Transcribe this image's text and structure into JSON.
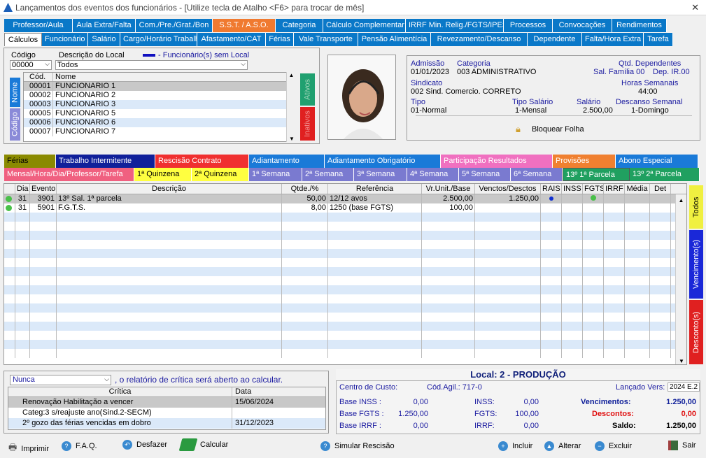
{
  "window": {
    "title": "Lançamentos dos eventos dos funcionários - [Utilize tecla de Atalho <F6> para trocar de mês]",
    "close": "✕"
  },
  "top_tabs_row1": [
    {
      "label": "Professor/Aula",
      "color": "#0a78c8"
    },
    {
      "label": "Aula Extra/Falta",
      "color": "#0a78c8"
    },
    {
      "label": "Com./Pre./Grat./Bon",
      "color": "#0a78c8"
    },
    {
      "label": "S.S.T. / A.S.O.",
      "color": "#f07a30"
    },
    {
      "label": "Categoria",
      "color": "#0a78c8"
    },
    {
      "label": "Cálculo Complementar",
      "color": "#0a78c8"
    },
    {
      "label": "IRRF Min. Relig./FGTS/IPESP",
      "color": "#0a78c8"
    },
    {
      "label": "Processos",
      "color": "#0a78c8"
    },
    {
      "label": "Convocações",
      "color": "#0a78c8"
    },
    {
      "label": "Rendimentos",
      "color": "#0a78c8"
    }
  ],
  "top_tabs_row2": [
    {
      "label": "Cálculos",
      "selected": true
    },
    {
      "label": "Funcionário"
    },
    {
      "label": "Salário"
    },
    {
      "label": "Cargo/Horário Trabalho"
    },
    {
      "label": "Afastamento/CAT"
    },
    {
      "label": "Férias"
    },
    {
      "label": "Vale Transporte"
    },
    {
      "label": "Pensão Alimentícia"
    },
    {
      "label": "Revezamento/Descanso"
    },
    {
      "label": "Dependente"
    },
    {
      "label": "Falta/Hora Extra"
    },
    {
      "label": "Tarefa"
    }
  ],
  "filter": {
    "codigo_label": "Código",
    "descricao_label": "Descrição do Local",
    "legend": "- Funcionário(s) sem Local",
    "codigo_value": "00000",
    "descricao_value": "Todos"
  },
  "emp_list": {
    "col_cod": "Cód.",
    "col_nome": "Nome",
    "rows": [
      {
        "cod": "00001",
        "nome": "FUNCIONARIO 1"
      },
      {
        "cod": "00002",
        "nome": "FUNCIONARIO 2"
      },
      {
        "cod": "00003",
        "nome": "FUNCIONARIO 3"
      },
      {
        "cod": "00005",
        "nome": "FUNCIONARIO 5"
      },
      {
        "cod": "00006",
        "nome": "FUNCIONARIO 6"
      },
      {
        "cod": "00007",
        "nome": "FUNCIONARIO 7"
      }
    ],
    "vtab_nome": "Nome",
    "vtab_codigo": "Código",
    "vtab_ativos": "Ativos",
    "vtab_inativos": "Inativos"
  },
  "info": {
    "admissao_l": "Admissão",
    "admissao": "01/01/2023",
    "categoria_l": "Categoria",
    "categoria": "003  ADMINISTRATIVO",
    "qtd_dep_l": "Qtd. Dependentes",
    "sal_familia": "Sal. Família 00",
    "dep_ir": "Dep. IR.00",
    "sindicato_l": "Sindicato",
    "sindicato": "002  Sind. Comercio. CORRETO",
    "horas_l": "Horas Semanais",
    "horas": "44:00",
    "tipo_l": "Tipo",
    "tipo": "01-Normal",
    "tipo_sal_l": "Tipo Salário",
    "tipo_sal": "1-Mensal",
    "salario_l": "Salário",
    "salario": "2.500,00",
    "desc_sem_l": "Descanso Semanal",
    "desc_sem": "1-Domingo",
    "bloquear": "Bloquear Folha"
  },
  "mid_tabs_row1": [
    {
      "label": "Férias",
      "color": "#8a8a00",
      "text": "#000"
    },
    {
      "label": "Trabalho Intermitente",
      "color": "#10209a",
      "text": "#fff"
    },
    {
      "label": "Rescisão Contrato",
      "color": "#f03030",
      "text": "#fff"
    },
    {
      "label": "Adiantamento",
      "color": "#1a7ad8",
      "text": "#fff"
    },
    {
      "label": "Adiantamento Obrigatório",
      "color": "#1a7ad8",
      "text": "#fff"
    },
    {
      "label": "Participação Resultados",
      "color": "#f070c0",
      "text": "#fff"
    },
    {
      "label": "Provisões",
      "color": "#f08030",
      "text": "#fff"
    },
    {
      "label": "Abono Especial",
      "color": "#1a7ad8",
      "text": "#fff"
    }
  ],
  "mid_tabs_row2": [
    {
      "label": "Mensal/Hora/Dia/Professor/Tarefa",
      "color": "#f06080",
      "text": "#fff"
    },
    {
      "label": "1ª Quinzena",
      "color": "#ffff40",
      "text": "#000"
    },
    {
      "label": "2ª Quinzena",
      "color": "#ffff40",
      "text": "#000"
    },
    {
      "label": "1ª Semana",
      "color": "#7a7ad0",
      "text": "#fff"
    },
    {
      "label": "2ª Semana",
      "color": "#7a7ad0",
      "text": "#fff"
    },
    {
      "label": "3ª Semana",
      "color": "#7a7ad0",
      "text": "#fff"
    },
    {
      "label": "4ª Semana",
      "color": "#7a7ad0",
      "text": "#fff"
    },
    {
      "label": "5ª Semana",
      "color": "#7a7ad0",
      "text": "#fff"
    },
    {
      "label": "6ª Semana",
      "color": "#7a7ad0",
      "text": "#fff"
    },
    {
      "label": "13º  1ª Parcela",
      "color": "#20a060",
      "text": "#fff",
      "selected": true
    },
    {
      "label": "13º  2ª Parcela",
      "color": "#20a060",
      "text": "#fff"
    }
  ],
  "events": {
    "headers": [
      "Dia",
      "Evento",
      "Descrição",
      "Qtde./%",
      "Referência",
      "Vr.Unit./Base",
      "Venctos/Desctos",
      "RAIS",
      "INSS",
      "FGTS",
      "IRRF",
      "Média",
      "Det"
    ],
    "rows": [
      {
        "dia": "31",
        "evento": "3901",
        "desc": "13º Sal. 1ª parcela",
        "qtde": "50,00",
        "ref": "12/12 avos",
        "vr": "2.500,00",
        "venc": "1.250,00"
      },
      {
        "dia": "31",
        "evento": "5901",
        "desc": "F.G.T.S.",
        "qtde": "8,00",
        "ref": "1250 (base FGTS)",
        "vr": "100,00",
        "venc": ""
      }
    ],
    "side_todos": "Todos",
    "side_venc": "Vencimento(s)",
    "side_desc": "Desconto(s)"
  },
  "critica": {
    "nunca": "Nunca",
    "text": ", o relatório de crítica será aberto ao calcular.",
    "col_critica": "Crítica",
    "col_data": "Data",
    "rows": [
      {
        "c": "Renovação Habilitação a vencer",
        "d": "15/06/2024"
      },
      {
        "c": "Categ:3 s/reajuste ano(Sind.2-SECM)",
        "d": ""
      },
      {
        "c": "2º gozo das férias vencidas em dobro",
        "d": "31/12/2023"
      }
    ]
  },
  "summary": {
    "local": "Local: 2 - PRODUÇÃO",
    "centro": "Centro de Custo:",
    "cod_agil": "Cód.Agil.: 717-0",
    "lancado": "Lançado Vers:",
    "versao": "2024 E.2",
    "base_inss_l": "Base INSS :",
    "base_inss": "0,00",
    "inss_l": "INSS:",
    "inss": "0,00",
    "venc_l": "Vencimentos:",
    "venc": "1.250,00",
    "base_fgts_l": "Base FGTS :",
    "base_fgts": "1.250,00",
    "fgts_l": "FGTS:",
    "fgts": "100,00",
    "desc_l": "Descontos:",
    "desc": "0,00",
    "base_irrf_l": "Base IRRF :",
    "base_irrf": "0,00",
    "irrf_l": "IRRF:",
    "irrf": "0,00",
    "saldo_l": "Saldo:",
    "saldo": "1.250,00"
  },
  "toolbar": {
    "imprimir": "Imprimir",
    "faq": "F.A.Q.",
    "desfazer": "Desfazer",
    "calcular": "Calcular",
    "simular": "Simular Rescisão",
    "incluir": "Incluir",
    "alterar": "Alterar",
    "excluir": "Excluir",
    "sair": "Sair"
  }
}
